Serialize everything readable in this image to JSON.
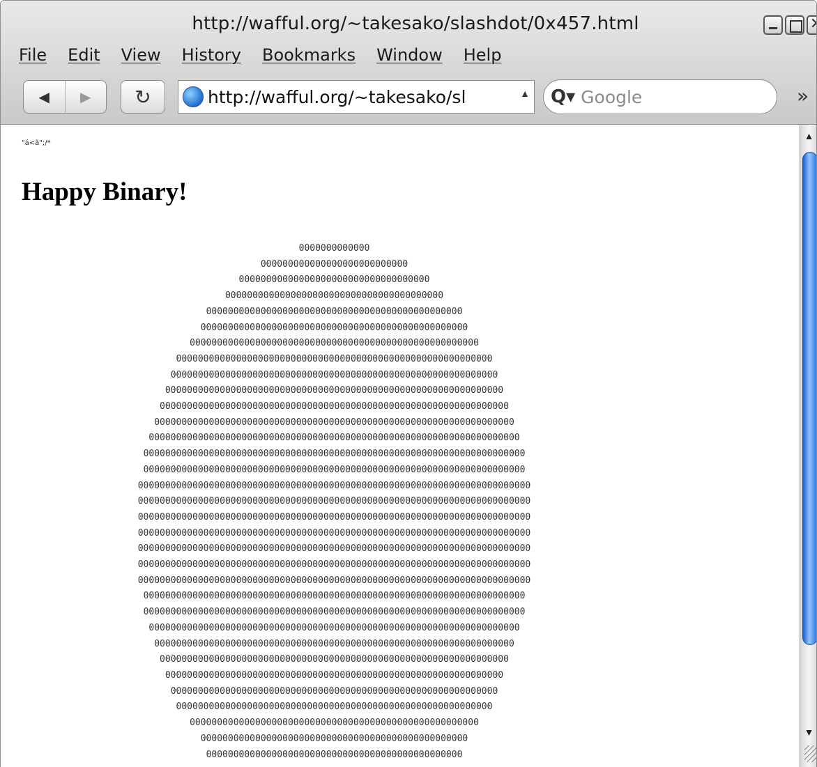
{
  "window": {
    "title": "http://wafful.org/~takesako/slashdot/0x457.html",
    "close_glyph": "✕"
  },
  "menubar": {
    "items": [
      "File",
      "Edit",
      "View",
      "History",
      "Bookmarks",
      "Window",
      "Help"
    ]
  },
  "toolbar": {
    "back_glyph": "◀",
    "forward_glyph": "▶",
    "reload_glyph": "↻",
    "url": "http://wafful.org/~takesako/sl",
    "url_dropdown_glyph": "▲",
    "search_icon_glyph": "Q▾",
    "search_placeholder": "Google",
    "overflow_glyph": "»"
  },
  "page": {
    "garbage_text": "\"á<ã\";/*",
    "heading": "Happy Binary!",
    "ascii_art": "0000000000000\n000000000000000000000000000\n00000000000000000000000000000000000\n0000000000000000000000000000000000000000\n00000000000000000000000000000000000000000000000\n0000000000000000000000000000000000000000000000000\n00000000000000000000000000000000000000000000000000000\n0000000000000000000000000000000000000000000000000000000000\n000000000000000000000000000000000000000000000000000000000000\n00000000000000000000000000000000000000000000000000000000000000\n0000000000000000000000000000000000000000000000000000000000000000\n000000000000000000000000000000000000000000000000000000000000000000\n00000000000000000000000000000000000000000000000000000000000000000000\n0000000000000000000000000000000000000000000000000000000000000000000000\n0000000000000000000000000000000000000000000000000000000000000000000000\n000000000000000000000000000000000000000000000000000000000000000000000000\n000000000000000000000000000000000000000000000000000000000000000000000000\n000000000000000000000000000000000000000000000000000000000000000000000000\n000000000000000000000000000000000000000000000000000000000000000000000000\n000000000000000000000000000000000000000000000000000000000000000000000000\n000000000000000000000000000000000000000000000000000000000000000000000000\n000000000000000000000000000000000000000000000000000000000000000000000000\n0000000000000000000000000000000000000000000000000000000000000000000000\n0000000000000000000000000000000000000000000000000000000000000000000000\n00000000000000000000000000000000000000000000000000000000000000000000\n000000000000000000000000000000000000000000000000000000000000000000\n0000000000000000000000000000000000000000000000000000000000000000\n00000000000000000000000000000000000000000000000000000000000000\n000000000000000000000000000000000000000000000000000000000000\n0000000000000000000000000000000000000000000000000000000000\n00000000000000000000000000000000000000000000000000000\n0000000000000000000000000000000000000000000000000\n00000000000000000000000000000000000000000000000"
  },
  "scrollbar": {
    "up_glyph": "▲",
    "down_glyph": "▼"
  },
  "colors": {
    "scroll_thumb": "#2f74d8",
    "chrome_top": "#e9e9e9",
    "chrome_bottom": "#c9c9c9"
  }
}
